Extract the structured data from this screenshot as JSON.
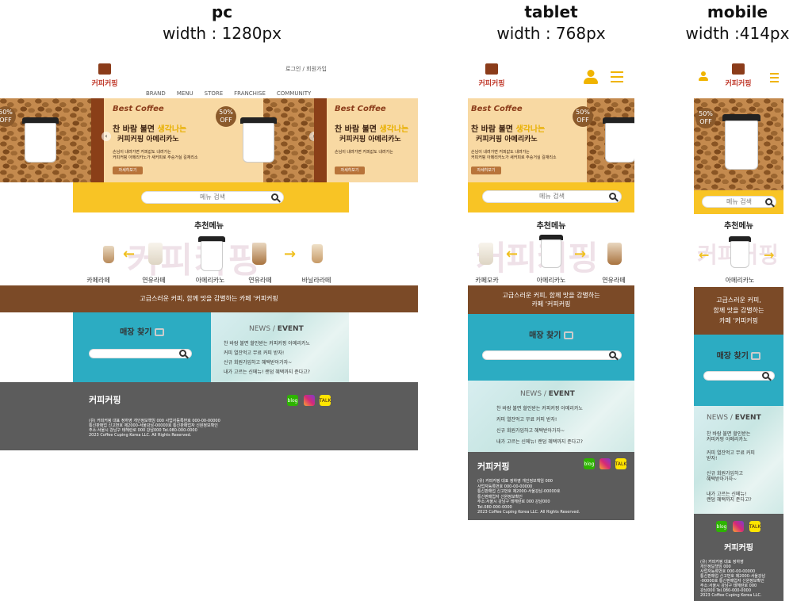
{
  "columns": {
    "pc": {
      "title": "pc",
      "width": "width : 1280px"
    },
    "tablet": {
      "title": "tablet",
      "width": "width : 768px"
    },
    "mobile": {
      "title": "mobile",
      "width": "width :414px"
    }
  },
  "brand": {
    "logo_text": "커피커핑"
  },
  "header": {
    "login": "로그인 / 회원가입"
  },
  "nav": [
    "BRAND",
    "MENU",
    "STORE",
    "FRANCHISE",
    "COMMUNITY"
  ],
  "banner": {
    "title": "Best Coffee",
    "headline_1": "찬 바람 불면",
    "headline_hl": "생각나는",
    "headline_2": "커피커핑 아메리카노",
    "body_1": "손님이 내려가면 커피값도 내려가는",
    "body_2": "커피커핑 아메리카노가 새커피로 주승거실 길재리소",
    "button": "자세히보기",
    "badge_pct": "50%",
    "badge_off": "OFF"
  },
  "search": {
    "placeholder": "메뉴 검색"
  },
  "recommend": {
    "title": "추천메뉴",
    "watermark": "커피커핑",
    "pc_items": [
      "카페라떼",
      "연유라떼",
      "아메리카노",
      "연유라떼",
      "바닐라라떼"
    ],
    "tablet_items": [
      "카페모카",
      "아메리카노",
      "연유라떼"
    ],
    "mobile_items": [
      "아메리카노"
    ]
  },
  "slogan": {
    "pc": "고급스러운 커피, 함께 맛을 감별하는 카페 '커피커핑",
    "tablet_1": "고급스러운 커피, 함께 맛을 감별하는",
    "tablet_2": "카페 '커피커핑",
    "mobile_1": "고급스러운 커피,",
    "mobile_2": "함께 맛을 감별하는",
    "mobile_3": "카페 '커피커핑"
  },
  "store": {
    "title": "매장 찾기"
  },
  "news": {
    "title_news": "NEWS",
    "sep": " / ",
    "title_event": "EVENT",
    "items": [
      "찬 바람 불면 할인받는 커피커핑 아메리카노",
      "커피 열잔먹고 무료 커피 받자!",
      "신규 회원가입하고 혜택받아가자~",
      "내가 고르는 신메뉴! 랜덤 혜택까지 준다고?"
    ],
    "mobile_items": [
      [
        "찬 바람 불면 할인받는",
        "커피커핑 아메리카노"
      ],
      [
        "커피 열잔먹고 무료 커피",
        "받자!"
      ],
      [
        "신규 회원가입하고",
        "혜택받아가자~"
      ],
      [
        "내가 고르는 신메뉴!",
        "랜덤 혜택까지 준다고?"
      ]
    ]
  },
  "footer": {
    "pc_lines": [
      "(유) 커피커핑 대표 정하영 개인정보책임 000 사업자등록번호 000-00-00000",
      "통신판매업 신고번호 제2000-서울강남-00000호 통신판매업자 신원정보확인",
      "주소:서울시 강남구 테헤란로 000 강남000 Tel.080-000-0000",
      "2023 Coffee Cuping Korea LLC. All Rights Reserved."
    ],
    "tablet_lines": [
      "(유) 커피커핑 대표 정하영 개인정보책임 000",
      "사업자등록번호 000-00-00000",
      "통신판매업 신고번호 제2000-서울강남-00000호",
      "통신판매업자 신원정보확인",
      "주소:서울시 강남구 테헤란로 000 강남000",
      "Tel.080-000-0000",
      "2023 Coffee Cuping Korea LLC. All Rights Reserved."
    ],
    "mobile_lines": [
      "(유) 커피커핑 대표 정하영",
      "개인정보책임 000",
      "사업자등록번호 000-00-00000",
      "통신판매업 신고번호 제2000-서울강남",
      "-00000호 통신판매업자 신원정보확인",
      "주소:서울시 강남구 테헤란로 000",
      "강남000 Tel.080-000-0000",
      "2023 Coffee Cuping Korea LLC."
    ],
    "sns": {
      "blog": "blog",
      "insta": "",
      "talk": "TALK"
    }
  },
  "colors": {
    "yellow": "#f8c425",
    "teal": "#2cacc2",
    "brown": "#7b4a27",
    "footer": "#5c5c5c"
  },
  "icons": [
    "search-icon",
    "person-icon",
    "hamburger-icon",
    "store-icon",
    "chevron-left-icon",
    "chevron-right-icon",
    "blog-icon",
    "instagram-icon",
    "kakaotalk-icon"
  ]
}
